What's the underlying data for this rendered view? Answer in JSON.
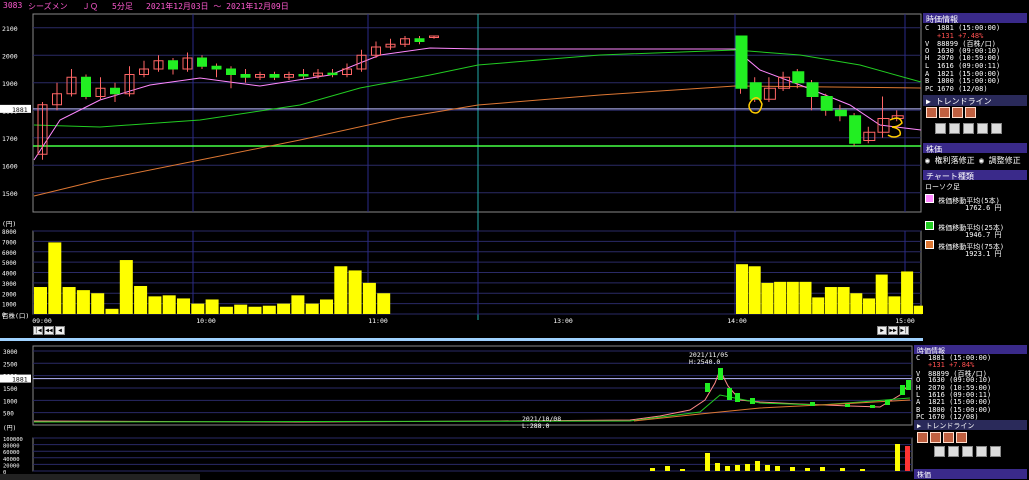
{
  "header": {
    "code": "3083",
    "name": "シーズメン",
    "market": "ＪＱ",
    "interval": "5分足",
    "range": "2021年12月03日 ～ 2021年12月09日"
  },
  "colors": {
    "up": "#ffff33",
    "down": "#22ee22",
    "price_line": "#ffffff",
    "support": "#44ff44",
    "ma5": "#ff88ff",
    "ma25": "#22cc22",
    "ma75": "#dd7733",
    "volume": "#ffff00",
    "annot": "#ffcc00"
  },
  "main_chart": {
    "price_ticks": [
      "2100",
      "2000",
      "1900",
      "1800",
      "1700",
      "1600",
      "1500"
    ],
    "last_price_label": "1881",
    "unit_label": "(円)",
    "volume_ticks": [
      "8000",
      "7000",
      "6000",
      "5000",
      "4000",
      "3000",
      "2000",
      "1000",
      "0"
    ],
    "volume_unit": "百株(口)",
    "time_labels": [
      "09:00",
      "10:00",
      "11:00",
      "13:00",
      "14:00",
      "15:00"
    ],
    "chart_data": {
      "type": "line",
      "xlabel": "",
      "ylabel": "",
      "ylim": [
        1430,
        2150
      ],
      "candles": [
        {
          "o": 1640,
          "c": 1820,
          "h": 1830,
          "l": 1620
        },
        {
          "o": 1820,
          "c": 1860,
          "h": 1900,
          "l": 1800
        },
        {
          "o": 1860,
          "c": 1920,
          "h": 1950,
          "l": 1850
        },
        {
          "o": 1920,
          "c": 1850,
          "h": 1930,
          "l": 1840
        },
        {
          "o": 1850,
          "c": 1880,
          "h": 1920,
          "l": 1840
        },
        {
          "o": 1880,
          "c": 1860,
          "h": 1900,
          "l": 1830
        },
        {
          "o": 1860,
          "c": 1930,
          "h": 1960,
          "l": 1850
        },
        {
          "o": 1930,
          "c": 1950,
          "h": 1980,
          "l": 1920
        },
        {
          "o": 1950,
          "c": 1980,
          "h": 2000,
          "l": 1940
        },
        {
          "o": 1980,
          "c": 1950,
          "h": 1990,
          "l": 1930
        },
        {
          "o": 1950,
          "c": 1990,
          "h": 2010,
          "l": 1940
        },
        {
          "o": 1990,
          "c": 1960,
          "h": 2000,
          "l": 1950
        },
        {
          "o": 1960,
          "c": 1950,
          "h": 1970,
          "l": 1920
        },
        {
          "o": 1950,
          "c": 1930,
          "h": 1960,
          "l": 1880
        },
        {
          "o": 1930,
          "c": 1920,
          "h": 1950,
          "l": 1900
        },
        {
          "o": 1920,
          "c": 1930,
          "h": 1940,
          "l": 1910
        },
        {
          "o": 1930,
          "c": 1920,
          "h": 1940,
          "l": 1910
        },
        {
          "o": 1920,
          "c": 1930,
          "h": 1940,
          "l": 1910
        },
        {
          "o": 1930,
          "c": 1925,
          "h": 1950,
          "l": 1915
        },
        {
          "o": 1925,
          "c": 1935,
          "h": 1950,
          "l": 1915
        },
        {
          "o": 1935,
          "c": 1930,
          "h": 1950,
          "l": 1920
        },
        {
          "o": 1930,
          "c": 1950,
          "h": 1970,
          "l": 1920
        },
        {
          "o": 1950,
          "c": 2000,
          "h": 2020,
          "l": 1940
        },
        {
          "o": 2000,
          "c": 2030,
          "h": 2050,
          "l": 1990
        },
        {
          "o": 2030,
          "c": 2040,
          "h": 2060,
          "l": 2020
        },
        {
          "o": 2040,
          "c": 2060,
          "h": 2070,
          "l": 2030
        },
        {
          "o": 2060,
          "c": 2050,
          "h": 2070,
          "l": 2040
        },
        {
          "o": 2070,
          "c": 2070,
          "h": 2070,
          "l": 2060
        }
      ],
      "candles_pm": [
        {
          "o": 2070,
          "c": 1880,
          "h": 2070,
          "l": 1860
        },
        {
          "o": 1900,
          "c": 1840,
          "h": 1920,
          "l": 1830
        },
        {
          "o": 1840,
          "c": 1880,
          "h": 1920,
          "l": 1830
        },
        {
          "o": 1880,
          "c": 1920,
          "h": 1940,
          "l": 1870
        },
        {
          "o": 1940,
          "c": 1900,
          "h": 1950,
          "l": 1880
        },
        {
          "o": 1900,
          "c": 1850,
          "h": 1910,
          "l": 1800
        },
        {
          "o": 1850,
          "c": 1800,
          "h": 1860,
          "l": 1780
        },
        {
          "o": 1800,
          "c": 1780,
          "h": 1820,
          "l": 1760
        },
        {
          "o": 1780,
          "c": 1680,
          "h": 1790,
          "l": 1670
        },
        {
          "o": 1690,
          "c": 1720,
          "h": 1740,
          "l": 1680
        },
        {
          "o": 1720,
          "c": 1770,
          "h": 1850,
          "l": 1700
        },
        {
          "o": 1770,
          "c": 1780,
          "h": 1800,
          "l": 1760
        }
      ],
      "volume_am": [
        2600,
        6900,
        2600,
        2300,
        2000,
        500,
        5200,
        2700,
        1700,
        1800,
        1500,
        1000,
        1400,
        700,
        900,
        700,
        800,
        1000,
        1800,
        1000,
        1400,
        4600,
        4200,
        3000,
        2000
      ],
      "volume_pm": [
        4800,
        4600,
        3000,
        3100,
        3100,
        3100,
        1600,
        2600,
        2600,
        2000,
        1500,
        3800,
        1700,
        4100,
        800
      ],
      "support_price": 1670,
      "current_price": 1805
    }
  },
  "main_sidebar": {
    "title": "時価情報",
    "rows": [
      {
        "k": "C",
        "v": "1881 (15:00:00)"
      },
      {
        "k": "",
        "v": "+131 +7.48%"
      },
      {
        "k": "V",
        "v": "88899 (百株/口)"
      },
      {
        "k": "O",
        "v": "1630 (09:00:10)"
      },
      {
        "k": "H",
        "v": "2070 (10:59:00)"
      },
      {
        "k": "L",
        "v": "1616 (09:00:11)"
      },
      {
        "k": "A",
        "v": "1821 (15:00:00)"
      },
      {
        "k": "B",
        "v": "1800 (15:00:00)"
      },
      {
        "k": "PC",
        "v": "1670 (12/08)"
      }
    ],
    "trendline": "トレンドライン",
    "kabuka": "株価",
    "opt1": "権利落修正",
    "opt2": "調整修正",
    "chart_kind": "チャート種類",
    "candle": "ローソク足",
    "ma": [
      {
        "label": "株価移動平均(5本)",
        "value": "1762.6 円"
      },
      {
        "label": "株価移動平均(25本)",
        "value": "1946.7 円"
      },
      {
        "label": "株価移動平均(75本)",
        "value": "1923.1 円"
      }
    ]
  },
  "sub_chart": {
    "price_ticks": [
      "3000",
      "2500",
      "2000",
      "1500",
      "1000",
      "500"
    ],
    "last_price_label": "1881",
    "unit_label": "(円)",
    "volume_ticks": [
      "100000",
      "80000",
      "60000",
      "40000",
      "20000",
      "0"
    ],
    "annot_high": "2021/11/05",
    "annot_high_val": "H:2540.0",
    "annot_low": "2021/10/08",
    "annot_low_val": "L:288.0",
    "sidebar_title": "時価情報",
    "rows": [
      {
        "k": "C",
        "v": "1881 (15:00:00)"
      },
      {
        "k": "",
        "v": "+131 +7.84%"
      },
      {
        "k": "V",
        "v": "88899 (百株/口)"
      },
      {
        "k": "O",
        "v": "1630 (09:00:10)"
      },
      {
        "k": "H",
        "v": "2070 (10:59:00)"
      },
      {
        "k": "L",
        "v": "1616 (09:00:11)"
      },
      {
        "k": "A",
        "v": "1821 (15:00:00)"
      },
      {
        "k": "B",
        "v": "1800 (15:00:00)"
      },
      {
        "k": "PC",
        "v": "1670 (12/08)"
      }
    ],
    "trendline": "トレンドライン",
    "kabuka": "株価"
  }
}
